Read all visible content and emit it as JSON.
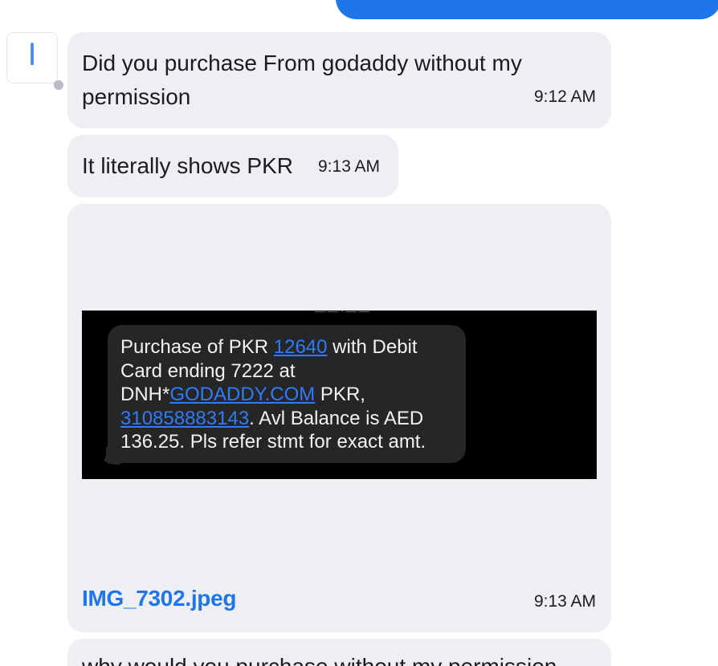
{
  "conversation": {
    "avatar_letter": "I",
    "messages": [
      {
        "text": "Did you purchase From godaddy without my permission",
        "time": "9:12 AM"
      },
      {
        "text": "It literally shows PKR",
        "time": "9:13 AM"
      },
      {
        "attachment": {
          "filename": "IMG_7302.jpeg",
          "time": "9:13 AM",
          "sms": {
            "t1": "Purchase of PKR ",
            "link1": "12640",
            "t2": " with Debit\nCard ending 7222 at\nDNH*",
            "link2": "GODADDY.COM",
            "t3": " PKR,\n",
            "link3": "310858883143",
            "t4": ". Avl Balance is AED\n136.25.  Pls refer stmt for exact amt."
          }
        }
      },
      {
        "text": "why would you purchase without my permission"
      }
    ]
  },
  "colors": {
    "accent": "#1f75ea",
    "bubble_incoming": "#eeeff2",
    "sms_bubble": "#262628",
    "sms_link": "#2e7cf6"
  }
}
